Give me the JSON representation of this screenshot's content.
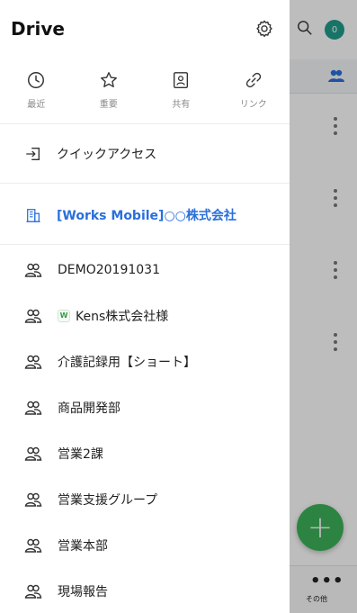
{
  "app": {
    "title": "Drive"
  },
  "background": {
    "avatar_text": "0",
    "more_label": "その他",
    "fab_symbol": "+",
    "colors": {
      "fab": "#3db25a",
      "avatar": "#1f9d8a"
    }
  },
  "quick": [
    {
      "icon": "clock-icon",
      "label": "最近"
    },
    {
      "icon": "star-icon",
      "label": "重要"
    },
    {
      "icon": "shared-icon",
      "label": "共有"
    },
    {
      "icon": "link-icon",
      "label": "リンク"
    }
  ],
  "menu": {
    "quick_access": "クイックアクセス",
    "org": "[Works Mobile]○○株式会社"
  },
  "groups": [
    {
      "label": "DEMO20191031"
    },
    {
      "label": "Kens株式会社様",
      "badge": "W"
    },
    {
      "label": "介護記録用【ショート】"
    },
    {
      "label": "商品開発部"
    },
    {
      "label": "営業2課"
    },
    {
      "label": "営業支援グループ"
    },
    {
      "label": "営業本部"
    },
    {
      "label": "現場報告"
    }
  ],
  "colors": {
    "accent": "#2a6fdc",
    "text": "#222222",
    "muted": "#8a8a8a"
  }
}
